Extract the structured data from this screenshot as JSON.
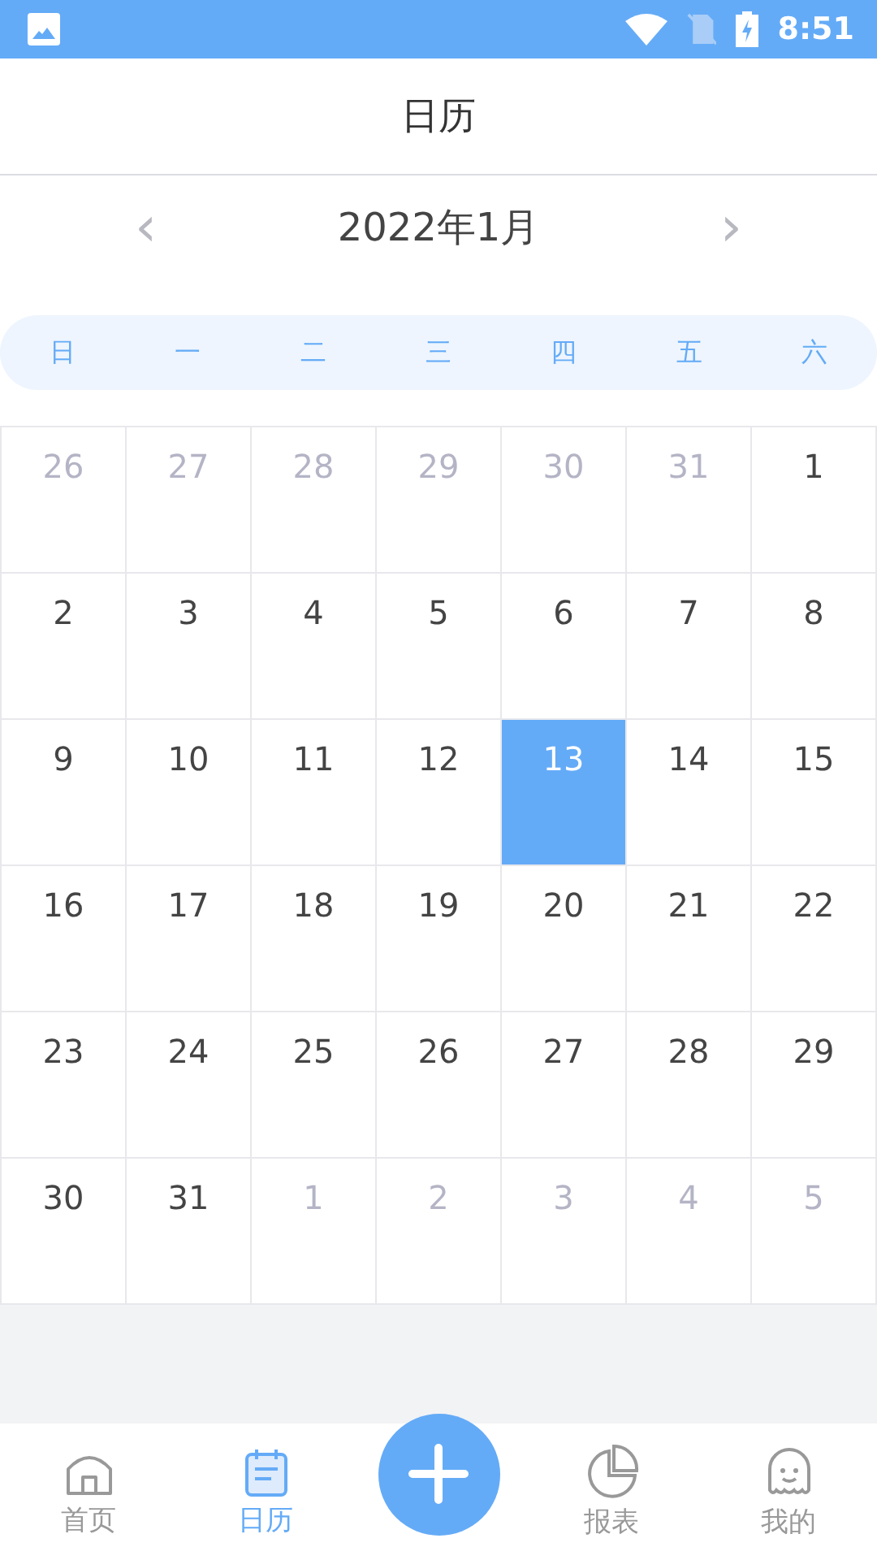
{
  "status_bar": {
    "time": "8:51"
  },
  "header": {
    "title": "日历"
  },
  "month_nav": {
    "prev": "‹",
    "label": "2022年1月",
    "next": "›"
  },
  "weekdays": [
    "日",
    "一",
    "二",
    "三",
    "四",
    "五",
    "六"
  ],
  "days": [
    {
      "label": "26",
      "muted": true,
      "selected": false
    },
    {
      "label": "27",
      "muted": true,
      "selected": false
    },
    {
      "label": "28",
      "muted": true,
      "selected": false
    },
    {
      "label": "29",
      "muted": true,
      "selected": false
    },
    {
      "label": "30",
      "muted": true,
      "selected": false
    },
    {
      "label": "31",
      "muted": true,
      "selected": false
    },
    {
      "label": "1",
      "muted": false,
      "selected": false
    },
    {
      "label": "2",
      "muted": false,
      "selected": false
    },
    {
      "label": "3",
      "muted": false,
      "selected": false
    },
    {
      "label": "4",
      "muted": false,
      "selected": false
    },
    {
      "label": "5",
      "muted": false,
      "selected": false
    },
    {
      "label": "6",
      "muted": false,
      "selected": false
    },
    {
      "label": "7",
      "muted": false,
      "selected": false
    },
    {
      "label": "8",
      "muted": false,
      "selected": false
    },
    {
      "label": "9",
      "muted": false,
      "selected": false
    },
    {
      "label": "10",
      "muted": false,
      "selected": false
    },
    {
      "label": "11",
      "muted": false,
      "selected": false
    },
    {
      "label": "12",
      "muted": false,
      "selected": false
    },
    {
      "label": "13",
      "muted": false,
      "selected": true
    },
    {
      "label": "14",
      "muted": false,
      "selected": false
    },
    {
      "label": "15",
      "muted": false,
      "selected": false
    },
    {
      "label": "16",
      "muted": false,
      "selected": false
    },
    {
      "label": "17",
      "muted": false,
      "selected": false
    },
    {
      "label": "18",
      "muted": false,
      "selected": false
    },
    {
      "label": "19",
      "muted": false,
      "selected": false
    },
    {
      "label": "20",
      "muted": false,
      "selected": false
    },
    {
      "label": "21",
      "muted": false,
      "selected": false
    },
    {
      "label": "22",
      "muted": false,
      "selected": false
    },
    {
      "label": "23",
      "muted": false,
      "selected": false
    },
    {
      "label": "24",
      "muted": false,
      "selected": false
    },
    {
      "label": "25",
      "muted": false,
      "selected": false
    },
    {
      "label": "26",
      "muted": false,
      "selected": false
    },
    {
      "label": "27",
      "muted": false,
      "selected": false
    },
    {
      "label": "28",
      "muted": false,
      "selected": false
    },
    {
      "label": "29",
      "muted": false,
      "selected": false
    },
    {
      "label": "30",
      "muted": false,
      "selected": false
    },
    {
      "label": "31",
      "muted": false,
      "selected": false
    },
    {
      "label": "1",
      "muted": true,
      "selected": false
    },
    {
      "label": "2",
      "muted": true,
      "selected": false
    },
    {
      "label": "3",
      "muted": true,
      "selected": false
    },
    {
      "label": "4",
      "muted": true,
      "selected": false
    },
    {
      "label": "5",
      "muted": true,
      "selected": false
    }
  ],
  "tab_bar": [
    {
      "kind": "home",
      "label": "首页",
      "selected": false
    },
    {
      "kind": "calendar",
      "label": "日历",
      "selected": true
    },
    {
      "kind": "add"
    },
    {
      "kind": "report",
      "label": "报表",
      "selected": false
    },
    {
      "kind": "profile",
      "label": "我的",
      "selected": false
    }
  ]
}
